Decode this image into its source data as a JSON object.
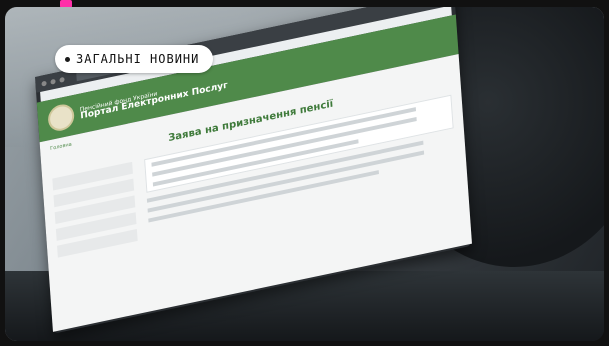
{
  "label": {
    "text": "ЗАГАЛЬНІ НОВИНИ"
  },
  "screen": {
    "site_title": "Портал Електронних Послуг",
    "site_subtitle": "Пенсійний фонд України",
    "page_title": "Заява на призначення пенсії",
    "nav_home": "Головна"
  },
  "colors": {
    "accent": "#4f8a4a",
    "brand": "#ff2fa8"
  }
}
